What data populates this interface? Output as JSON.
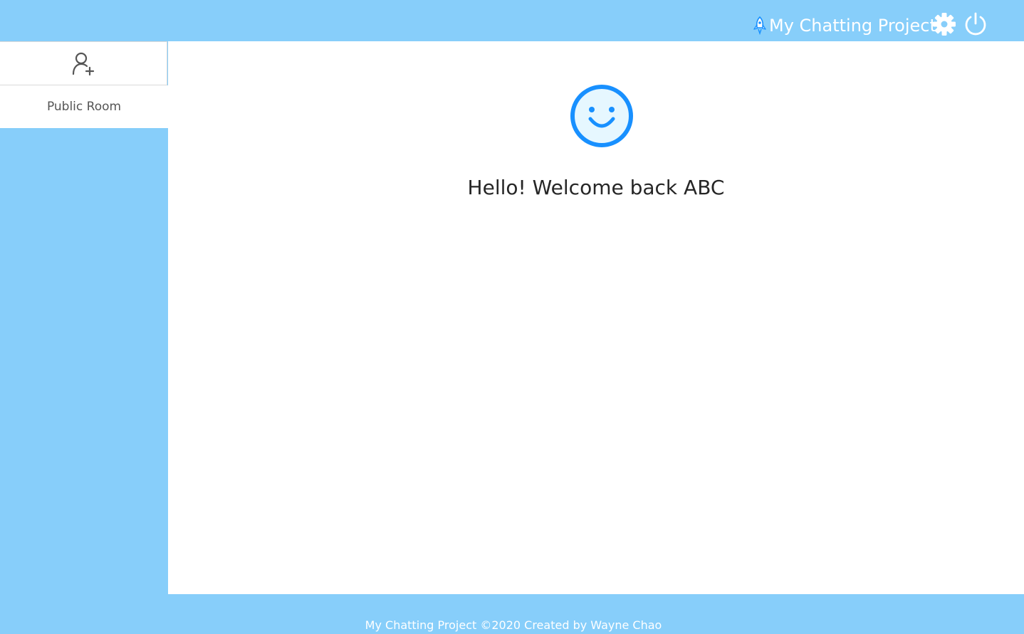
{
  "header": {
    "brand_icon": "rocket-icon",
    "title": "My Chatting Project",
    "settings_icon": "gear-icon",
    "logout_icon": "power-icon"
  },
  "sidebar": {
    "add_icon": "add-user-icon",
    "rooms": [
      {
        "label": "Public Room"
      }
    ]
  },
  "main": {
    "status_icon": "smile-icon",
    "welcome_text": "Hello! Welcome back ABC"
  },
  "footer": {
    "text": "My Chatting Project ©2020 Created by Wayne Chao"
  },
  "colors": {
    "background": "#87cefa",
    "accent": "#1890ff",
    "panel": "#ffffff"
  }
}
